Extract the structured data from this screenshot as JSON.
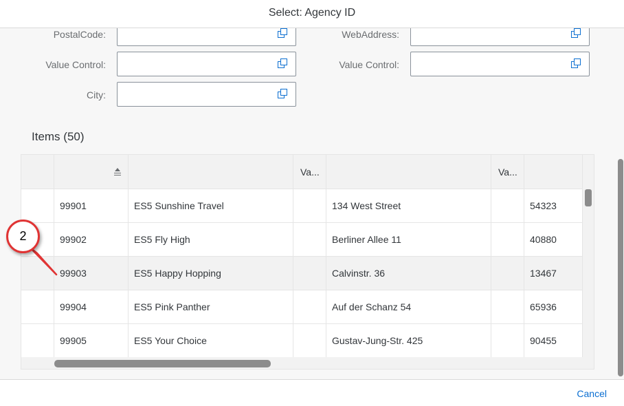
{
  "dialog": {
    "title": "Select: Agency ID"
  },
  "filters": [
    {
      "label": "PostalCode:",
      "value": ""
    },
    {
      "label": "WebAddress:",
      "value": ""
    },
    {
      "label": "Value Control:",
      "value": ""
    },
    {
      "label": "Value Control:",
      "value": ""
    },
    {
      "label": "City:",
      "value": ""
    }
  ],
  "items": {
    "title": "Items (50)",
    "columns": [
      "",
      "",
      "",
      "Va...",
      "",
      "Va...",
      ""
    ],
    "sorted_column_index": 1,
    "sort_icon": "sort-ascending-icon",
    "rows": [
      {
        "id": "99901",
        "name": "ES5 Sunshine Travel",
        "street": "134 West Street",
        "postal": "54323"
      },
      {
        "id": "99902",
        "name": "ES5 Fly High",
        "street": "Berliner Allee 11",
        "postal": "40880"
      },
      {
        "id": "99903",
        "name": "ES5 Happy Hopping",
        "street": "Calvinstr. 36",
        "postal": "13467"
      },
      {
        "id": "99904",
        "name": "ES5 Pink Panther",
        "street": "Auf der Schanz 54",
        "postal": "65936"
      },
      {
        "id": "99905",
        "name": "ES5 Your Choice",
        "street": "Gustav-Jung-Str. 425",
        "postal": "90455"
      }
    ],
    "hovered_row_index": 2
  },
  "footer": {
    "cancel_label": "Cancel"
  },
  "annotation": {
    "label": "2"
  },
  "colors": {
    "accent": "#0a6ed1",
    "callout_border": "#e03434",
    "header_bg": "#f2f2f2"
  }
}
